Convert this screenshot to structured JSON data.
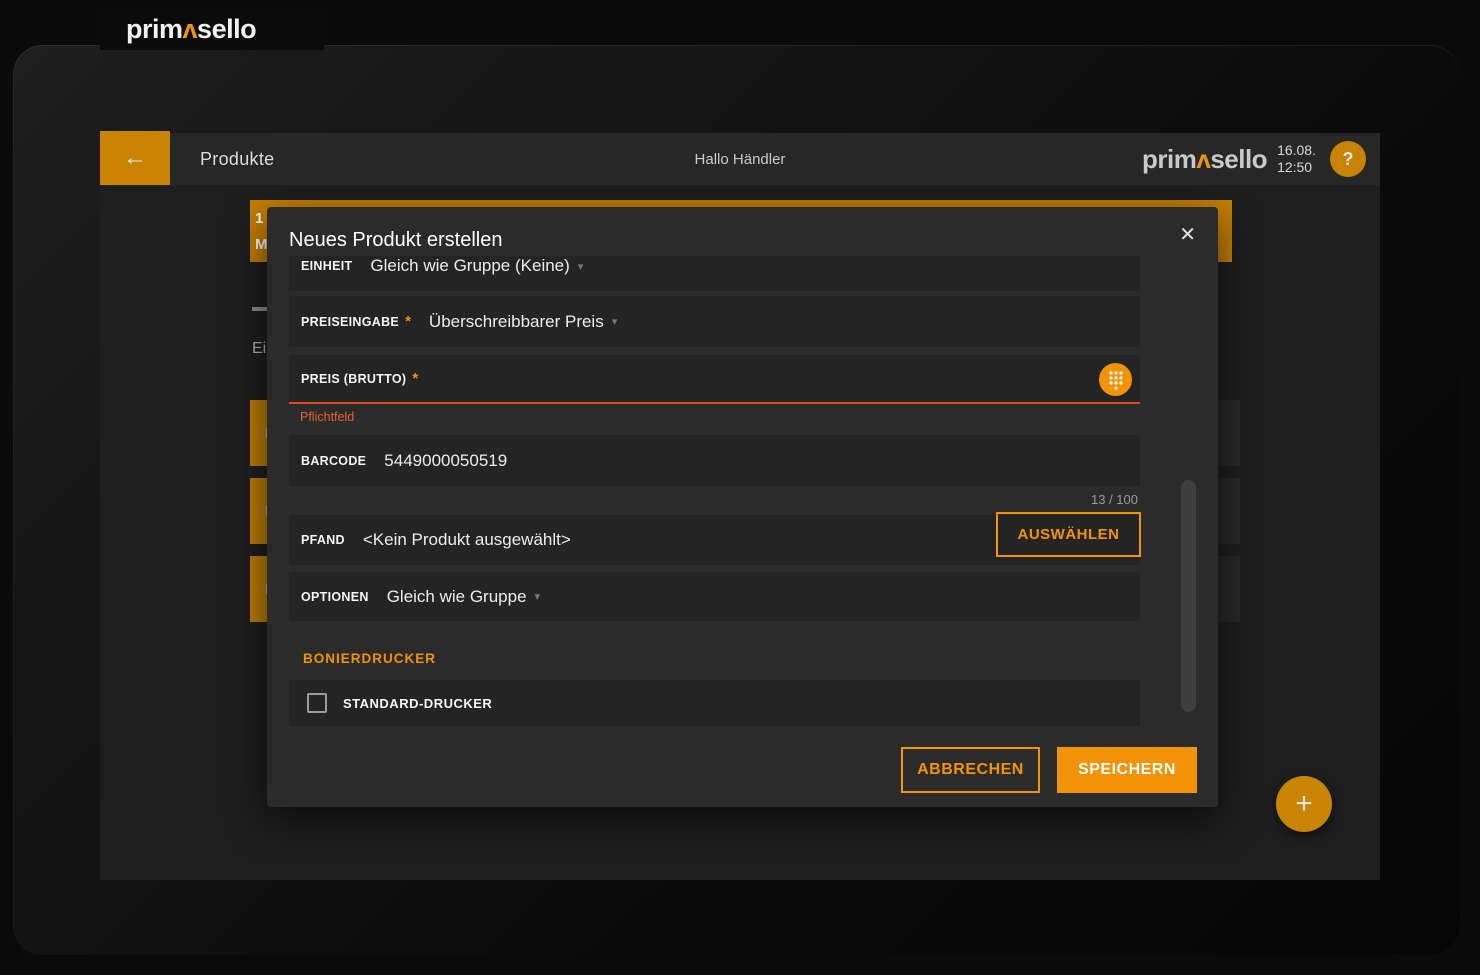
{
  "colors": {
    "accent_bright": "#f39203",
    "accent_dark": "#c98300",
    "error": "#e1491c",
    "modal_bg": "#2b2b2b",
    "row_bg": "#242424"
  },
  "logo": {
    "part1": "prim",
    "caret": "ʌ",
    "part3": "sello"
  },
  "icons": {
    "back": "←",
    "close": "✕",
    "dropdown": "▾",
    "plus": "+",
    "help": "?",
    "keypad": "dialpad-icon",
    "product_tile": "package-box-icon"
  },
  "header": {
    "title": "Produkte",
    "greeting": "Hallo Händler",
    "date": "16.08.",
    "time": "12:50"
  },
  "background": {
    "banner_line1": "1",
    "banner_line2": "M",
    "partial_label": "Ei"
  },
  "modal": {
    "title": "Neues Produkt erstellen",
    "einheit": {
      "label": "EINHEIT",
      "value": "Gleich wie Gruppe (Keine)"
    },
    "preiseingabe": {
      "label": "PREISEINGABE",
      "required": "*",
      "value": "Überschreibbarer Preis"
    },
    "preis_brutto": {
      "label": "PREIS (BRUTTO)",
      "required": "*",
      "value": "",
      "error": "Pflichtfeld"
    },
    "barcode": {
      "label": "BARCODE",
      "value": "5449000050519",
      "counter": "13 / 100"
    },
    "pfand": {
      "label": "PFAND",
      "value": "<Kein Produkt ausgewählt>",
      "button": "AUSWÄHLEN"
    },
    "optionen": {
      "label": "OPTIONEN",
      "value": "Gleich wie Gruppe"
    },
    "bonierdrucker": {
      "section": "BONIERDRUCKER",
      "checkbox_label": "STANDARD-DRUCKER",
      "checked": false
    },
    "footer": {
      "cancel": "ABBRECHEN",
      "save": "SPEICHERN"
    }
  }
}
